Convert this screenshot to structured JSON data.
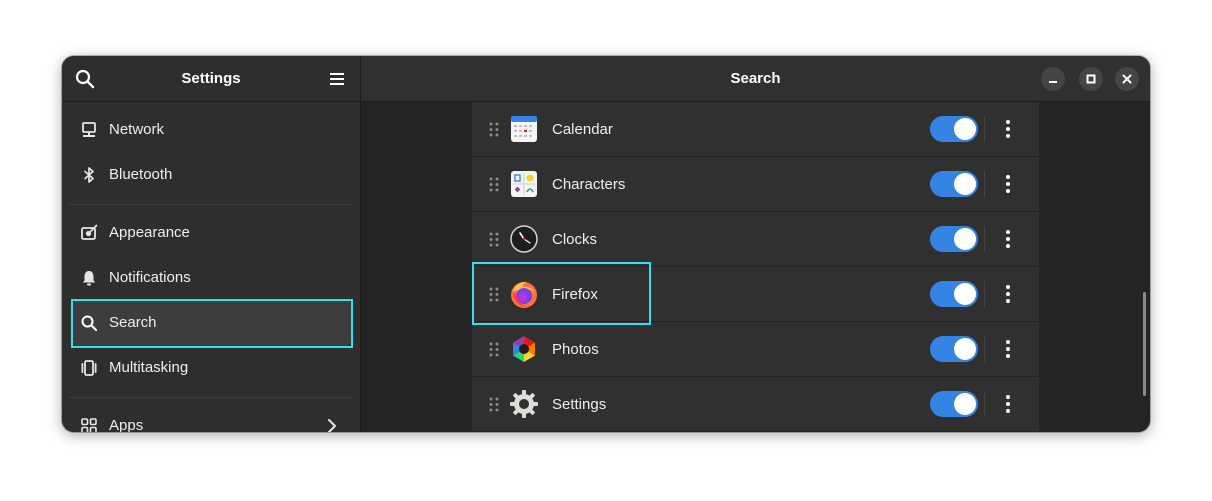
{
  "sidebar": {
    "title": "Settings",
    "items": [
      {
        "label": "Network",
        "icon": "network-icon"
      },
      {
        "label": "Bluetooth",
        "icon": "bluetooth-icon"
      },
      {
        "label": "Appearance",
        "icon": "appearance-icon"
      },
      {
        "label": "Notifications",
        "icon": "bell-icon"
      },
      {
        "label": "Search",
        "icon": "search-icon",
        "selected": true
      },
      {
        "label": "Multitasking",
        "icon": "multitasking-icon"
      },
      {
        "label": "Apps",
        "icon": "apps-grid-icon"
      }
    ]
  },
  "header": {
    "title": "Search"
  },
  "search_apps": [
    {
      "label": "Calendar",
      "icon": "calendar-icon",
      "enabled": true
    },
    {
      "label": "Characters",
      "icon": "characters-icon",
      "enabled": true
    },
    {
      "label": "Clocks",
      "icon": "clocks-icon",
      "enabled": true
    },
    {
      "label": "Firefox",
      "icon": "firefox-icon",
      "enabled": true
    },
    {
      "label": "Photos",
      "icon": "photos-icon",
      "enabled": true
    },
    {
      "label": "Settings",
      "icon": "settings-gear-icon",
      "enabled": true
    }
  ],
  "colors": {
    "accent": "#3584e4",
    "highlight": "#2ee1ee",
    "window_bg": "#242424",
    "sidebar_bg": "#2e2e2e"
  }
}
